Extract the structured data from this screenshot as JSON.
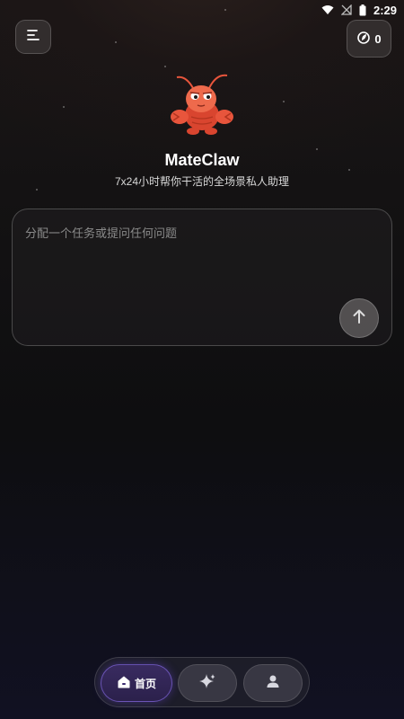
{
  "status_bar": {
    "time": "2:29",
    "icons": [
      "wifi-icon",
      "signal-off-icon",
      "battery-icon"
    ]
  },
  "header": {
    "menu_icon": "menu-icon",
    "credits_icon": "leaf-coin-icon",
    "credits_count": "0"
  },
  "hero": {
    "mascot": "lobster-mascot",
    "title": "MateClaw",
    "subtitle": "7x24小时帮你干活的全场景私人助理"
  },
  "composer": {
    "value": "",
    "placeholder": "分配一个任务或提问任何问题",
    "send_icon": "arrow-up-icon"
  },
  "bottom_nav": {
    "items": [
      {
        "label": "首页",
        "icon": "home-icon",
        "active": true
      },
      {
        "label": "",
        "icon": "sparkle-icon",
        "active": false
      },
      {
        "label": "",
        "icon": "person-icon",
        "active": false
      }
    ]
  },
  "colors": {
    "accent": "#7b5cff",
    "mascot_red": "#e8553c"
  }
}
